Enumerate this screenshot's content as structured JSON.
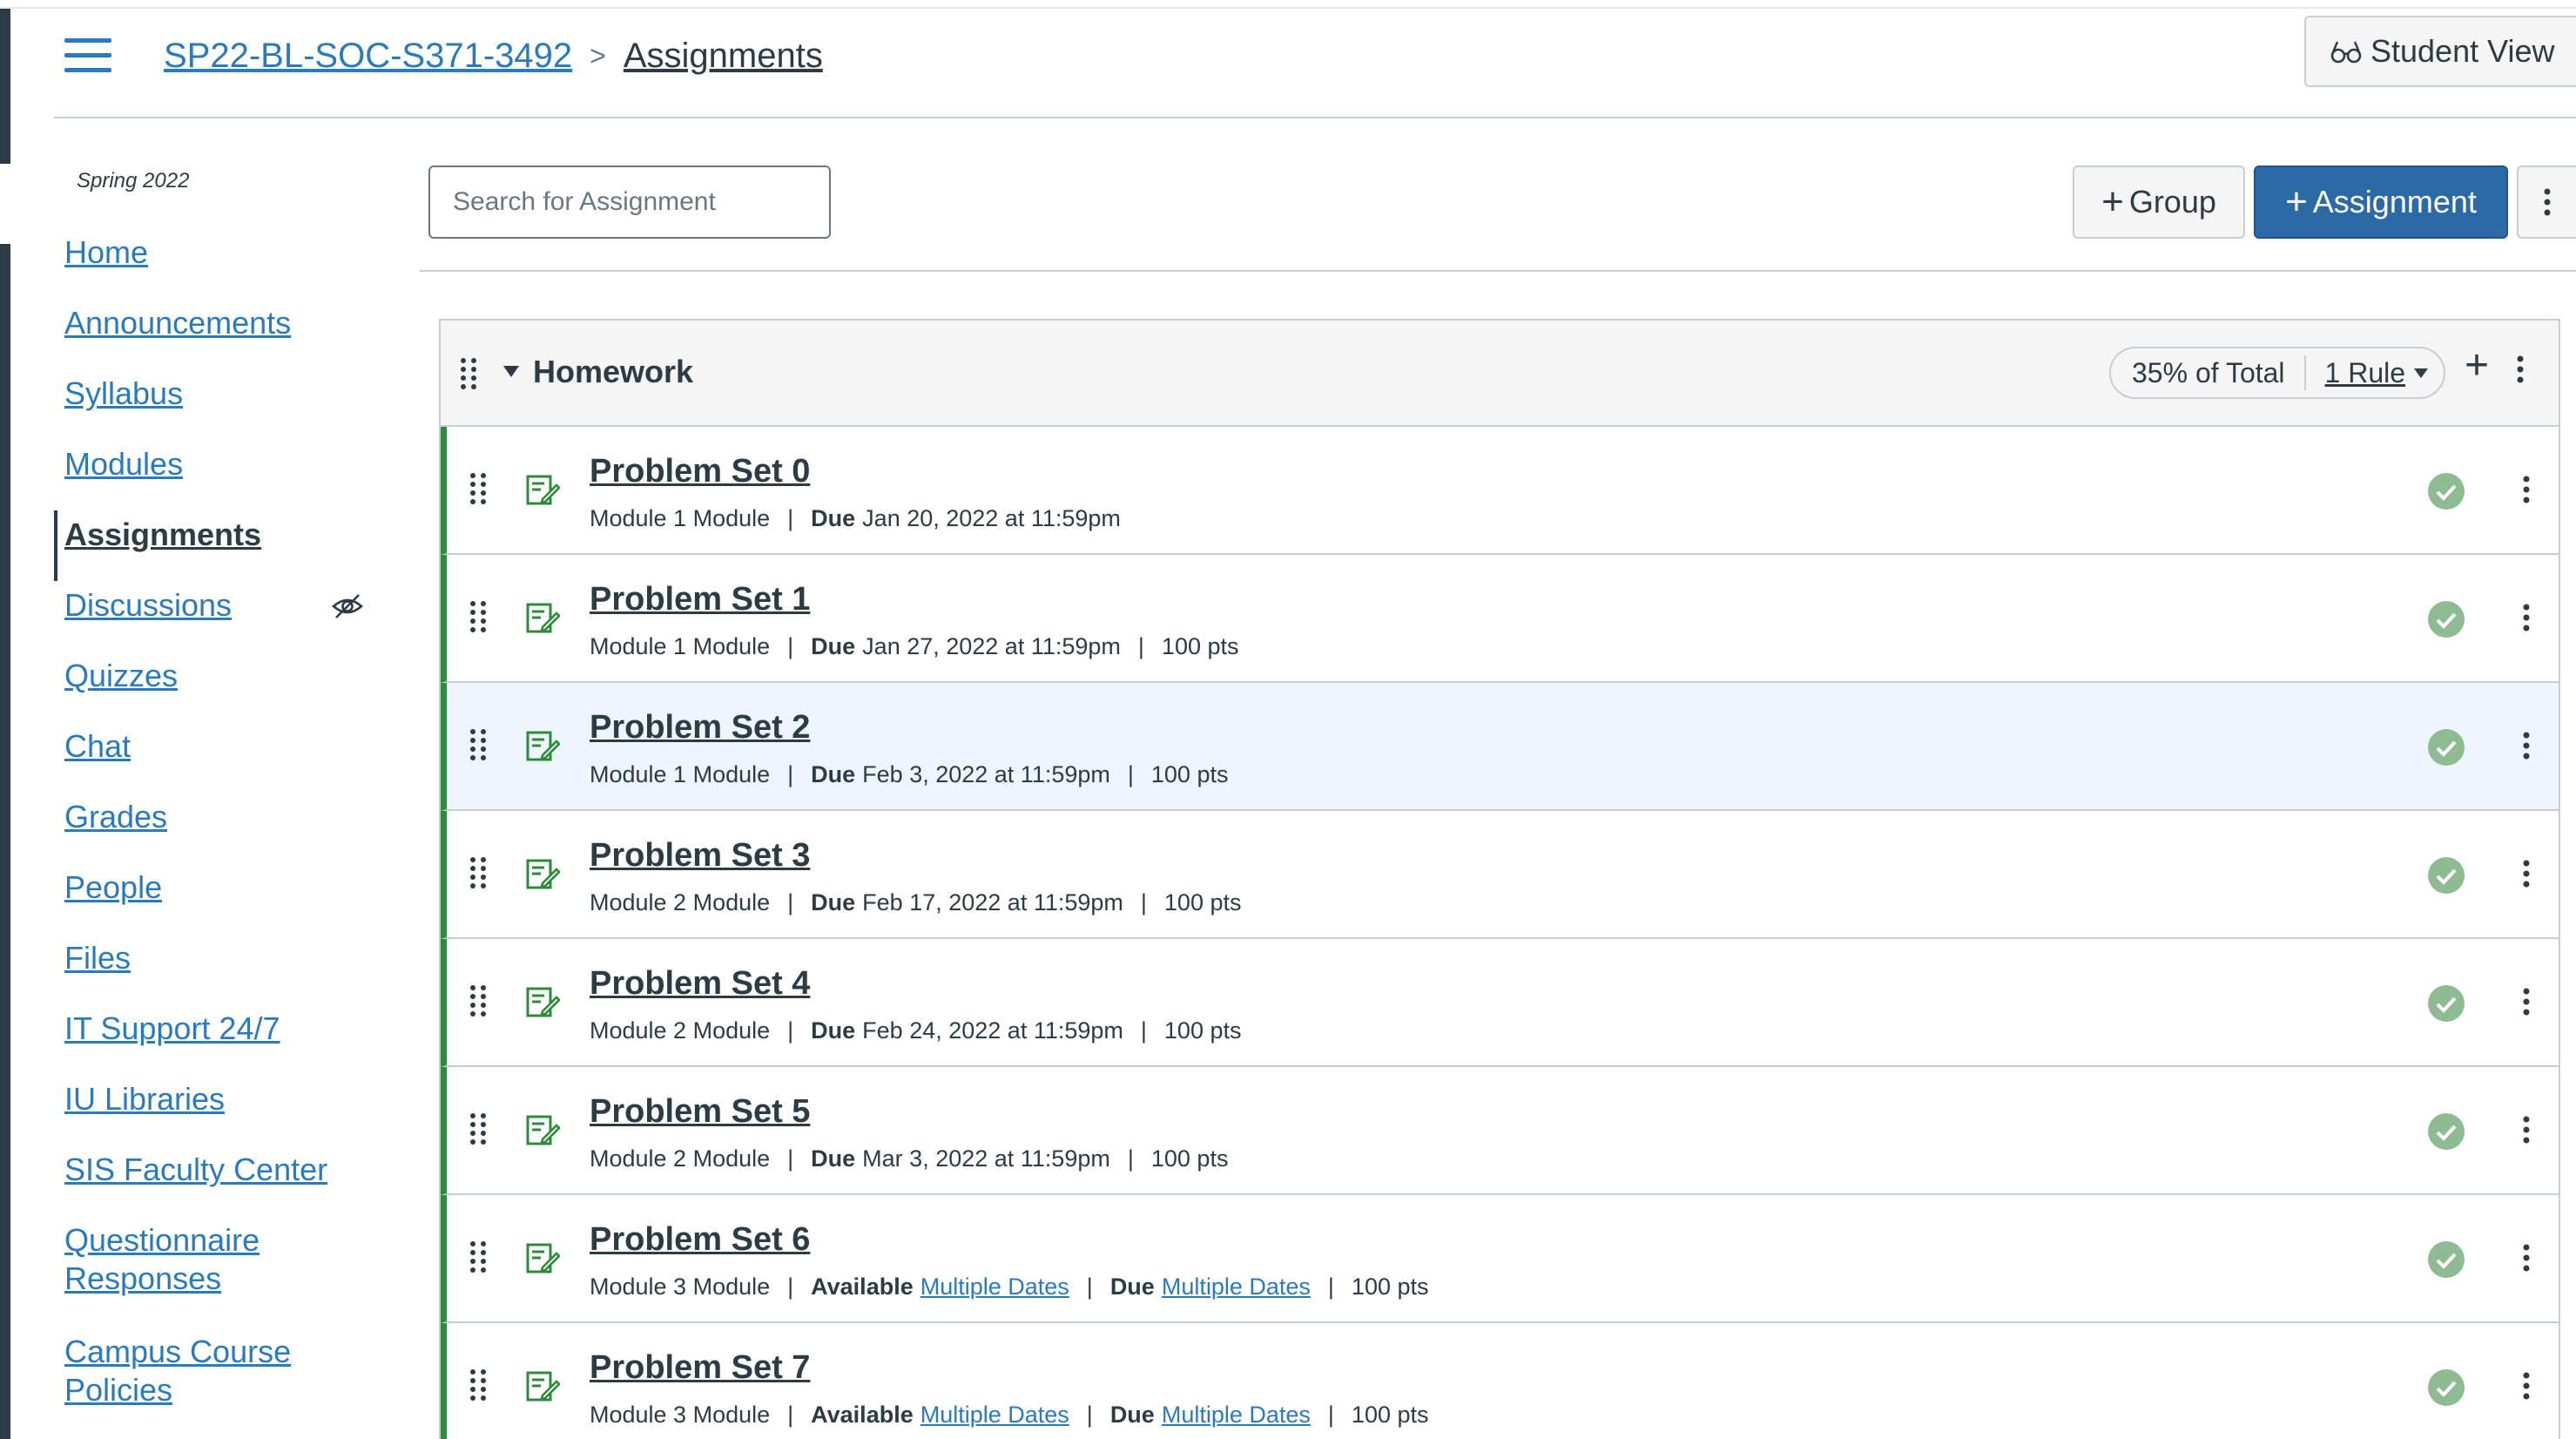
{
  "header": {
    "course": "SP22-BL-SOC-S371-3492",
    "separator": ">",
    "current": "Assignments",
    "student_view": "Student View"
  },
  "sidebar": {
    "term": "Spring 2022",
    "items": [
      {
        "label": "Home"
      },
      {
        "label": "Announcements"
      },
      {
        "label": "Syllabus"
      },
      {
        "label": "Modules"
      },
      {
        "label": "Assignments"
      },
      {
        "label": "Discussions"
      },
      {
        "label": "Quizzes"
      },
      {
        "label": "Chat"
      },
      {
        "label": "Grades"
      },
      {
        "label": "People"
      },
      {
        "label": "Files"
      },
      {
        "label": "IT Support 24/7"
      },
      {
        "label": "IU Libraries"
      },
      {
        "label": "SIS Faculty Center"
      },
      {
        "label": "Questionnaire Responses"
      },
      {
        "label": "Campus Course Policies"
      }
    ]
  },
  "toolbar": {
    "search_placeholder": "Search for Assignment",
    "group_label": "Group",
    "assignment_label": "Assignment",
    "plus": "+"
  },
  "group": {
    "title": "Homework",
    "weight": "35% of Total",
    "rules": "1 Rule",
    "plus": "+"
  },
  "labels": {
    "due": "Due",
    "available": "Available",
    "pipe": "|"
  },
  "assignments": [
    {
      "title": "Problem Set 0",
      "module": "Module 1 Module",
      "due": "Jan 20, 2022 at 11:59pm",
      "points": ""
    },
    {
      "title": "Problem Set 1",
      "module": "Module 1 Module",
      "due": "Jan 27, 2022 at 11:59pm",
      "points": "100 pts"
    },
    {
      "title": "Problem Set 2",
      "module": "Module 1 Module",
      "due": "Feb 3, 2022 at 11:59pm",
      "points": "100 pts"
    },
    {
      "title": "Problem Set 3",
      "module": "Module 2 Module",
      "due": "Feb 17, 2022 at 11:59pm",
      "points": "100 pts"
    },
    {
      "title": "Problem Set 4",
      "module": "Module 2 Module",
      "due": "Feb 24, 2022 at 11:59pm",
      "points": "100 pts"
    },
    {
      "title": "Problem Set 5",
      "module": "Module 2 Module",
      "due": "Mar 3, 2022 at 11:59pm",
      "points": "100 pts"
    },
    {
      "title": "Problem Set 6",
      "module": "Module 3 Module",
      "available": "Multiple Dates",
      "due": "Multiple Dates",
      "points": "100 pts"
    },
    {
      "title": "Problem Set 7",
      "module": "Module 3 Module",
      "available": "Multiple Dates",
      "due": "Multiple Dates",
      "points": "100 pts"
    }
  ],
  "colors": {
    "link": "#2b7abc",
    "primary": "#2b6aa5",
    "published": "#2f8a3c",
    "check": "#8fbb93",
    "text": "#2d3b45"
  },
  "icons": {
    "menu": "hamburger-icon",
    "student_view": "glasses-icon",
    "assignment": "assignment-icon",
    "published": "check-circle-icon",
    "more": "kebab-icon",
    "drag": "drag-handle-icon",
    "hidden": "eye-off-icon"
  }
}
